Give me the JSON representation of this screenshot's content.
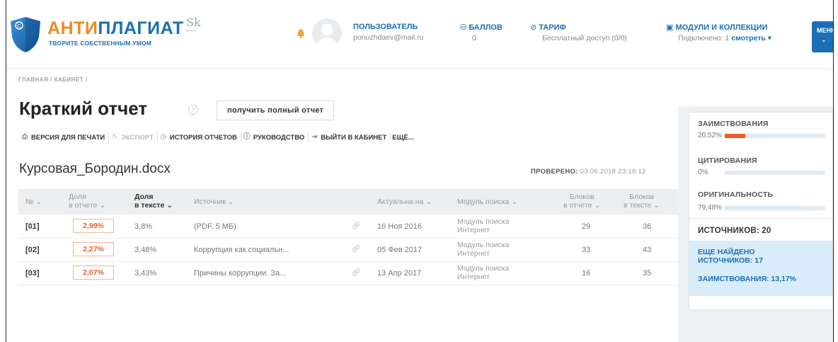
{
  "header": {
    "logo_title_a": "АНТИ",
    "logo_title_b": "ПЛАГИАТ",
    "logo_subtitle": "ТВОРИТЕ СОБСТВЕННЫМ УМОМ",
    "partner_logo": "Sk",
    "user": {
      "label": "ПОЛЬЗОВАТЕЛЬ",
      "value": "ponuzhdaev@mail.ru"
    },
    "points": {
      "label": "БАЛЛОВ",
      "value": "0"
    },
    "tariff": {
      "label": "ТАРИФ",
      "value": "Бесплатный доступ (0/0)"
    },
    "modules": {
      "label": "МОДУЛИ И КОЛЛЕКЦИИ",
      "value_prefix": "Подключено: 1",
      "value_link": "смотреть"
    },
    "menu_label": "МЕНЮ"
  },
  "breadcrumb": "ГЛАВНАЯ / КАБИНЕТ /",
  "page_title": "Краткий отчет",
  "full_report_button": "получить полный отчет",
  "toolbar": {
    "print": "ВЕРСИЯ ДЛЯ ПЕЧАТИ",
    "export": "ЭКСПОРТ",
    "history": "ИСТОРИЯ ОТЧЕТОВ",
    "guide": "РУКОВОДСТВО",
    "exit": "ВЫЙТИ В КАБИНЕТ",
    "more": "ЕЩЁ..."
  },
  "document": {
    "name": "Курсовая_Бородин.docx",
    "checked_label": "ПРОВЕРЕНО:",
    "checked_value": "03.06.2018 23:18:12"
  },
  "table": {
    "headers": {
      "num": "№",
      "share_report_1": "Доля",
      "share_report_2": "в отчете",
      "share_text_1": "Доля",
      "share_text_2": "в тексте",
      "source": "Источник",
      "actual": "Актуальна на",
      "module": "Модуль поиска",
      "blocks_report_1": "Блоков",
      "blocks_report_2": "в отчете",
      "blocks_text_1": "Блоков",
      "blocks_text_2": "в тексте"
    },
    "rows": [
      {
        "num": "[01]",
        "share_report": "2,99%",
        "share_text": "3,8%",
        "source": "(PDF, 5 МБ)",
        "date": "16 Ноя 2016",
        "module_1": "Модуль поиска",
        "module_2": "Интернет",
        "blocks_report": "29",
        "blocks_text": "36"
      },
      {
        "num": "[02]",
        "share_report": "2,27%",
        "share_text": "3,48%",
        "source": "Коррупция как социальн...",
        "date": "05 Фев 2017",
        "module_1": "Модуль поиска",
        "module_2": "Интернет",
        "blocks_report": "33",
        "blocks_text": "43"
      },
      {
        "num": "[03]",
        "share_report": "2,07%",
        "share_text": "3,43%",
        "source": "Причины коррупции. За...",
        "date": "13 Апр 2017",
        "module_1": "Модуль поиска",
        "module_2": "Интернет",
        "blocks_report": "16",
        "blocks_text": "35"
      }
    ]
  },
  "summary": {
    "borrowing": {
      "label": "ЗАИМСТВОВАНИЯ",
      "value": "20,52%",
      "fraction": 0.2052,
      "color": "#ef5a2a"
    },
    "citation": {
      "label": "ЦИТИРОВАНИЯ",
      "value": "0%",
      "fraction": 0,
      "color": "#8bc34a"
    },
    "originality": {
      "label": "ОРИГИНАЛЬНОСТЬ",
      "value": "79,48%",
      "fraction": 0.7948,
      "color": "#d6e9f8"
    },
    "sources": "ИСТОЧНИКОВ: 20",
    "found_more": "ЕЩЕ НАЙДЕНО ИСТОЧНИКОВ: 17",
    "borrowing_more": "ЗАИМСТВОВАНИЯ: 13,17%"
  }
}
